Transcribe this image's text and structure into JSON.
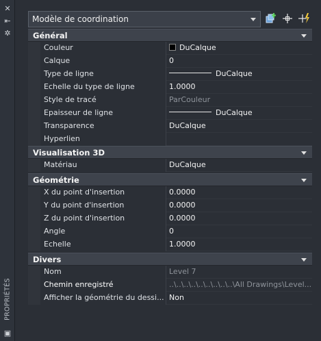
{
  "palette": {
    "title": "PROPRIÉTÉS"
  },
  "selector": {
    "value": "Modèle de coordination"
  },
  "toolbar_icons": [
    "add-selection-icon",
    "select-objects-icon",
    "quick-select-icon"
  ],
  "sections": {
    "general": {
      "title": "Général",
      "rows": [
        {
          "label": "Couleur",
          "value": "DuCalque"
        },
        {
          "label": "Calque",
          "value": "0"
        },
        {
          "label": "Type de ligne",
          "value": "DuCalque"
        },
        {
          "label": "Echelle du type de ligne",
          "value": "1.0000"
        },
        {
          "label": "Style de tracé",
          "value": "ParCouleur"
        },
        {
          "label": "Epaisseur de ligne",
          "value": "DuCalque"
        },
        {
          "label": "Transparence",
          "value": "DuCalque"
        },
        {
          "label": "Hyperlien",
          "value": ""
        }
      ]
    },
    "visu3d": {
      "title": "Visualisation 3D",
      "rows": [
        {
          "label": "Matériau",
          "value": "DuCalque"
        }
      ]
    },
    "geometrie": {
      "title": "Géométrie",
      "rows": [
        {
          "label": "X du point d'insertion",
          "value": "0.0000"
        },
        {
          "label": "Y du point d'insertion",
          "value": "0.0000"
        },
        {
          "label": "Z du point d'insertion",
          "value": "0.0000"
        },
        {
          "label": "Angle",
          "value": "0"
        },
        {
          "label": "Echelle",
          "value": "1.0000"
        }
      ]
    },
    "divers": {
      "title": "Divers",
      "rows": [
        {
          "label": "Nom",
          "value": "Level 7"
        },
        {
          "label": "Chemin enregistré",
          "value": "..\\..\\..\\..\\..\\..\\..\\..\\..\\All Drawings\\Level..."
        },
        {
          "label": "Afficher la géométrie du dessi...",
          "value": "Non"
        }
      ]
    }
  },
  "colors": {
    "background": "#2b2f36",
    "section": "#3e434c",
    "text": "#e8e8e8",
    "dimmed": "#8e939a"
  }
}
